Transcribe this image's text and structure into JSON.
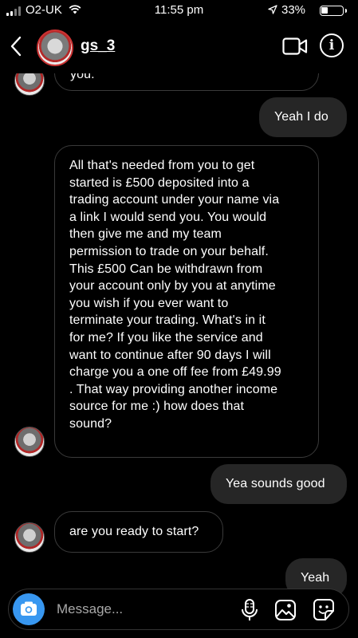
{
  "status_bar": {
    "carrier": "O2-UK",
    "time": "11:55 pm",
    "battery": "33%"
  },
  "header": {
    "username": "gs_3"
  },
  "messages": [
    {
      "from": "them",
      "text": "you."
    },
    {
      "from": "me",
      "text": "Yeah I do"
    },
    {
      "from": "them",
      "lines": [
        "All that's needed from you to get",
        "started is £500 deposited into a",
        "trading account under your name via",
        "a link I would send you. You would",
        "then give me and my team",
        "permission to trade on your behalf.",
        "This £500 Can be withdrawn from",
        "your account only by you at anytime",
        "you wish if you ever want to",
        "terminate your trading.  What's in it",
        "for me? If you like the service and",
        "want to continue after 90 days I will",
        "charge you a one off fee from £49.99",
        ". That way providing another income",
        "source for me :)  how does that",
        "sound?"
      ]
    },
    {
      "from": "me",
      "text": "Yea sounds good"
    },
    {
      "from": "them",
      "text": "are you ready to start?"
    },
    {
      "from": "me",
      "text": "Yeah"
    }
  ],
  "composer": {
    "placeholder": "Message..."
  }
}
